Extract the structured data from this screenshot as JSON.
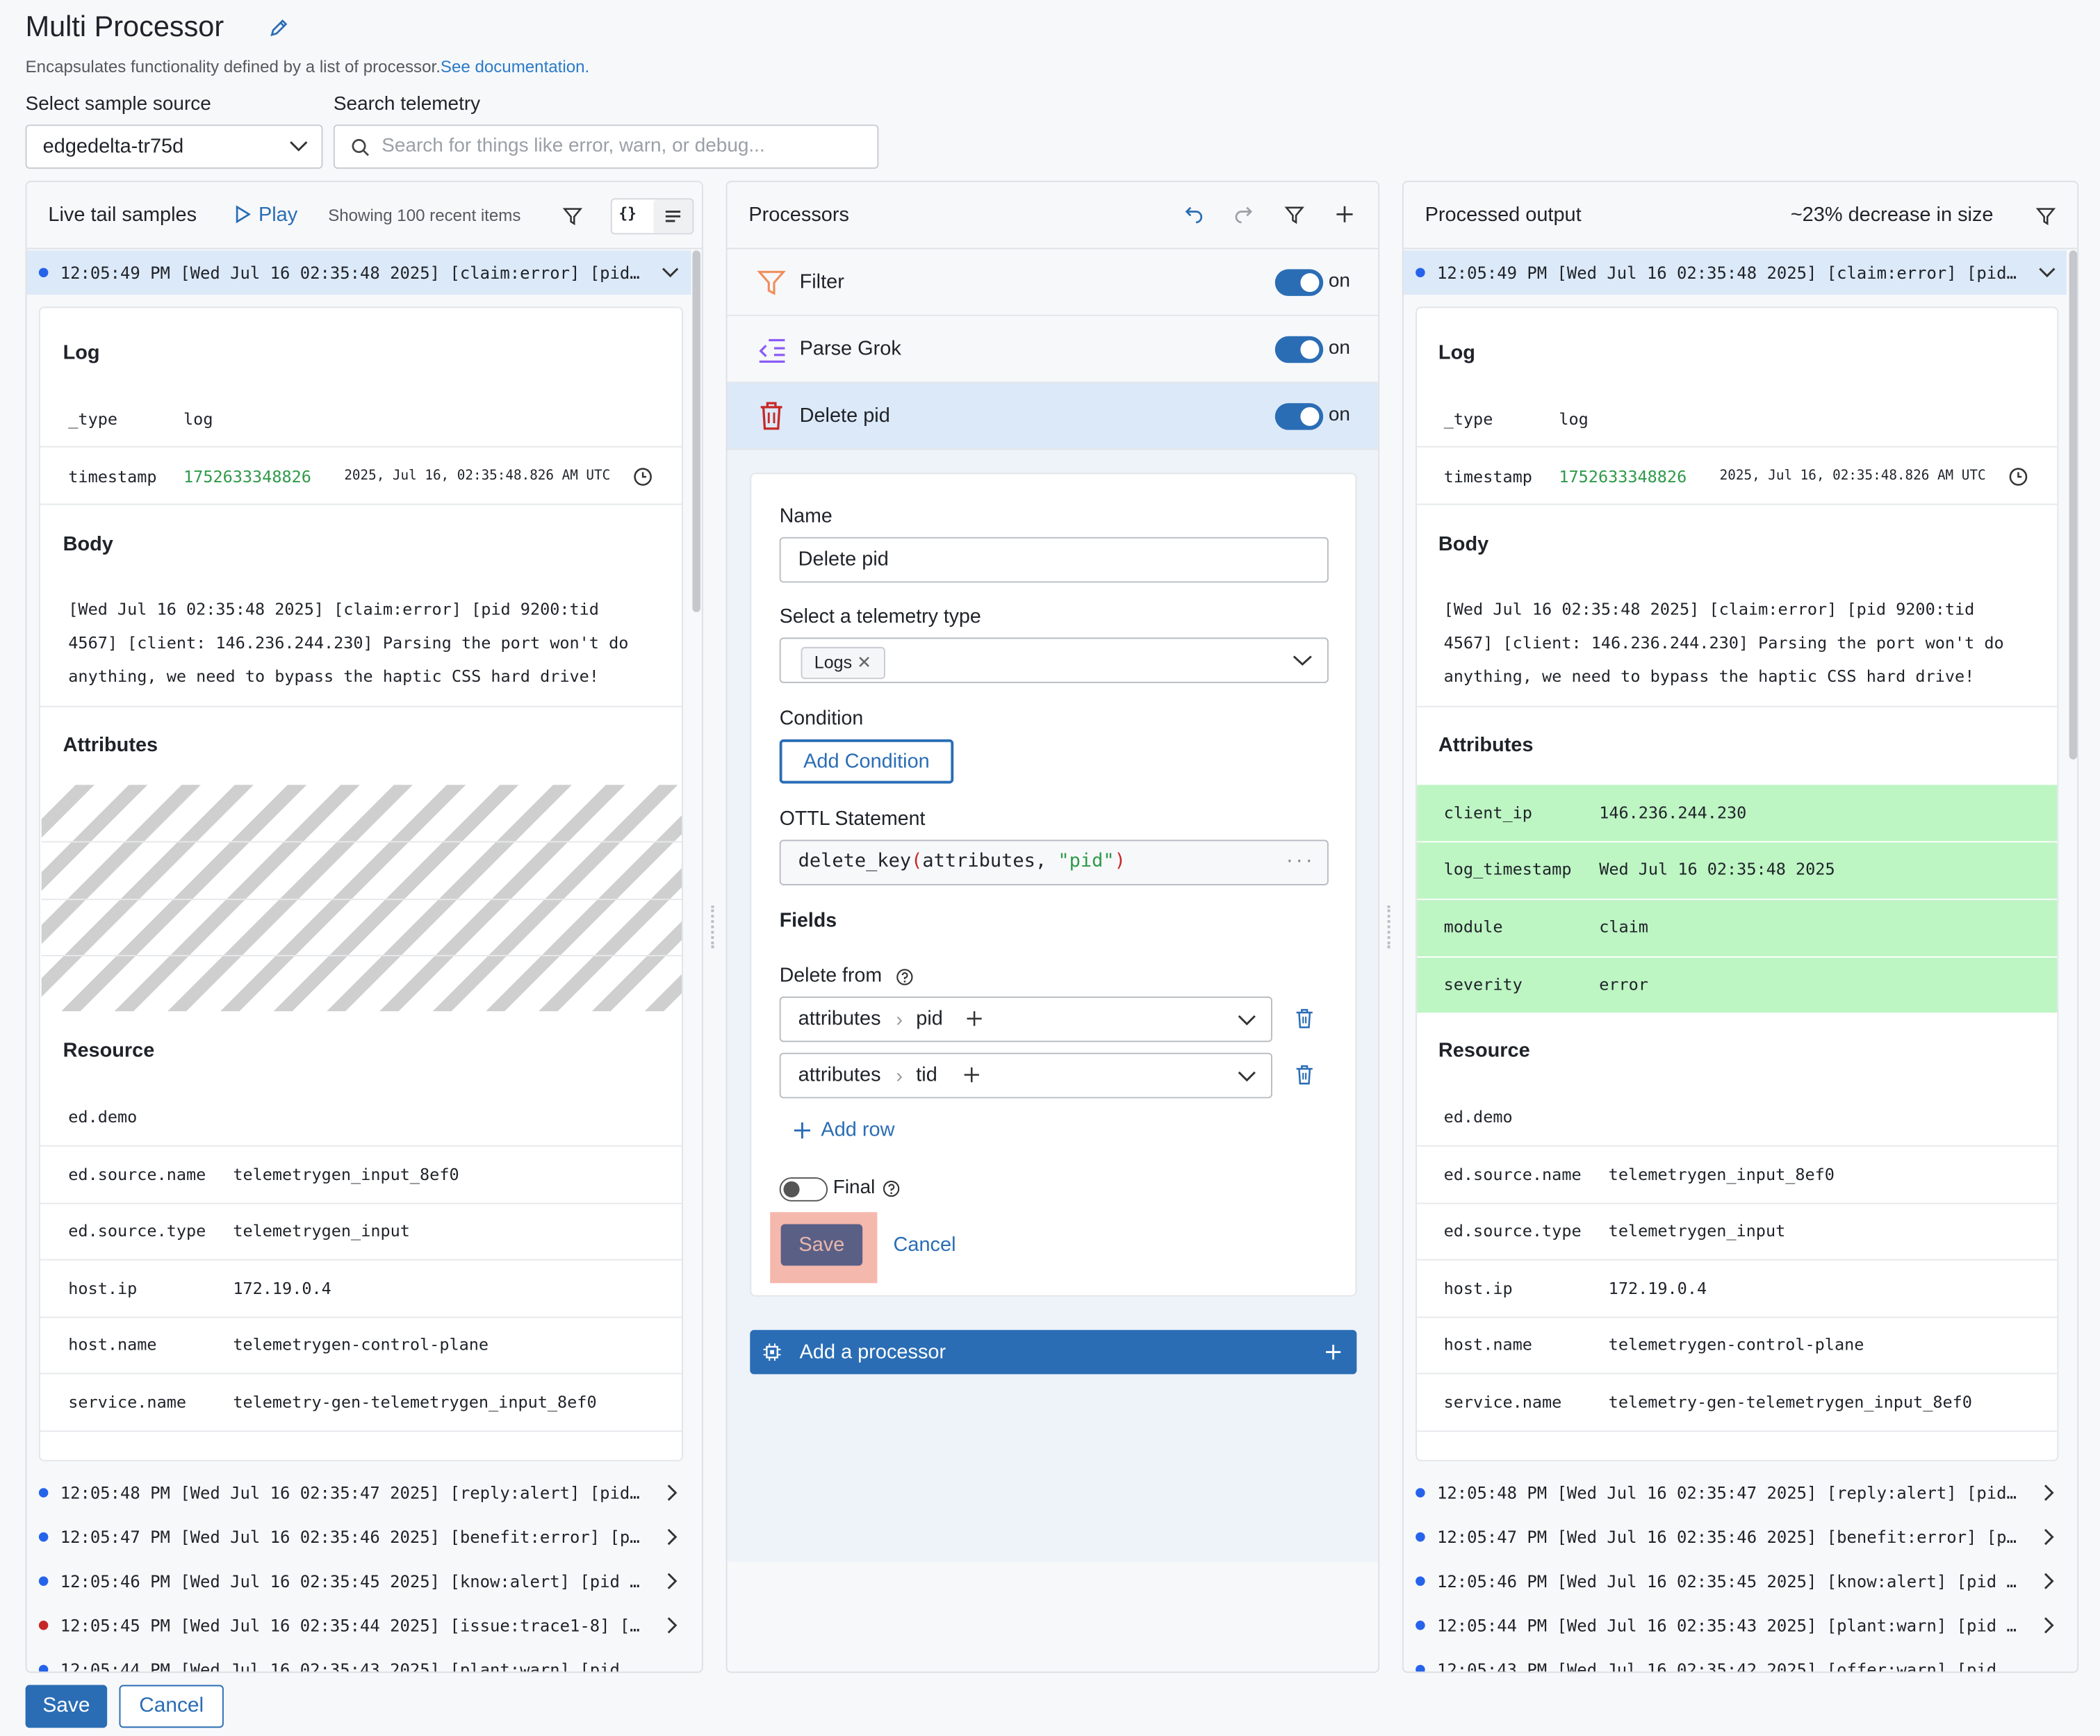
{
  "header": {
    "title": "Multi Processor",
    "description": "Encapsulates functionality defined by a list of processor.",
    "doc_link": "See documentation.",
    "source_label": "Select sample source",
    "source_value": "edgedelta-tr75d",
    "search_label": "Search telemetry",
    "search_placeholder": "Search for things like error, warn, or debug..."
  },
  "live": {
    "title": "Live tail samples",
    "play": "Play",
    "showing": "Showing 100 recent items",
    "json_icon": "{}",
    "selected": "12:05:49 PM [Wed Jul 16 02:35:48 2025] [claim:error] [pid…",
    "log_section": "Log",
    "type_key": "_type",
    "type_val": "log",
    "ts_key": "timestamp",
    "ts_val": "1752633348826",
    "ts_human": "2025, Jul 16, 02:35:48.826 AM UTC",
    "body_section": "Body",
    "body_lines": [
      "[Wed Jul 16 02:35:48 2025] [claim:error] [pid 9200:tid",
      "4567] [client: 146.236.244.230] Parsing the port won't do",
      "anything, we need to bypass the haptic CSS hard drive!"
    ],
    "attr_section": "Attributes",
    "res_section": "Resource",
    "resources": [
      {
        "k": "ed.demo",
        "v": ""
      },
      {
        "k": "ed.source.name",
        "v": "telemetrygen_input_8ef0"
      },
      {
        "k": "ed.source.type",
        "v": "telemetrygen_input"
      },
      {
        "k": "host.ip",
        "v": "172.19.0.4"
      },
      {
        "k": "host.name",
        "v": "telemetrygen-control-plane"
      },
      {
        "k": "service.name",
        "v": "telemetry-gen-telemetrygen_input_8ef0"
      }
    ],
    "lines": [
      {
        "t": "12:05:48 PM [Wed Jul 16 02:35:47 2025] [reply:alert] [pid…",
        "c": "#2563eb"
      },
      {
        "t": "12:05:47 PM [Wed Jul 16 02:35:46 2025] [benefit:error] [p…",
        "c": "#2563eb"
      },
      {
        "t": "12:05:46 PM [Wed Jul 16 02:35:45 2025] [know:alert] [pid …",
        "c": "#2563eb"
      },
      {
        "t": "12:05:45 PM [Wed Jul 16 02:35:44 2025] [issue:trace1-8] […",
        "c": "#c62828"
      },
      {
        "t": "12:05:44 PM [Wed Jul 16 02:35:43 2025] [plant:warn] [pid…",
        "c": "#2563eb"
      }
    ]
  },
  "processors": {
    "title": "Processors",
    "items": [
      {
        "name": "Filter",
        "state": "on"
      },
      {
        "name": "Parse Grok",
        "state": "on"
      },
      {
        "name": "Delete pid",
        "state": "on"
      }
    ],
    "form": {
      "name_label": "Name",
      "name_value": "Delete pid",
      "type_label": "Select a telemetry type",
      "type_tag": "Logs",
      "cond_label": "Condition",
      "add_condition": "Add Condition",
      "ottl_label": "OTTL Statement",
      "ottl_fn": "delete_key",
      "ottl_open": "(",
      "ottl_arg": "attributes, ",
      "ottl_str": "\"pid\"",
      "ottl_close": ")",
      "fields_label": "Fields",
      "delete_from": "Delete from",
      "rows": [
        {
          "a": "attributes",
          "b": "pid"
        },
        {
          "a": "attributes",
          "b": "tid"
        }
      ],
      "add_row": "Add row",
      "final_label": "Final",
      "save": "Save",
      "cancel": "Cancel"
    },
    "add_processor": "Add a processor"
  },
  "output": {
    "title": "Processed output",
    "decrease": "~23% decrease in size",
    "selected": "12:05:49 PM [Wed Jul 16 02:35:48 2025] [claim:error] [pid…",
    "attributes": [
      {
        "k": "client_ip",
        "v": "146.236.244.230"
      },
      {
        "k": "log_timestamp",
        "v": "Wed Jul 16 02:35:48 2025"
      },
      {
        "k": "module",
        "v": "claim"
      },
      {
        "k": "severity",
        "v": "error"
      }
    ],
    "lines": [
      {
        "t": "12:05:48 PM [Wed Jul 16 02:35:47 2025] [reply:alert] [pid…",
        "c": "#2563eb"
      },
      {
        "t": "12:05:47 PM [Wed Jul 16 02:35:46 2025] [benefit:error] [p…",
        "c": "#2563eb"
      },
      {
        "t": "12:05:46 PM [Wed Jul 16 02:35:45 2025] [know:alert] [pid …",
        "c": "#2563eb"
      },
      {
        "t": "12:05:44 PM [Wed Jul 16 02:35:43 2025] [plant:warn] [pid …",
        "c": "#2563eb"
      },
      {
        "t": "12:05:43 PM [Wed Jul 16 02:35:42 2025] [offer:warn] [pid…",
        "c": "#2563eb"
      }
    ]
  },
  "footer": {
    "save": "Save",
    "cancel": "Cancel"
  },
  "colors": {
    "accent": "#2a6db5",
    "selected_row": "#dce9f8",
    "added_attr": "#bdf5c3",
    "highlight": "#f5b8ad"
  }
}
